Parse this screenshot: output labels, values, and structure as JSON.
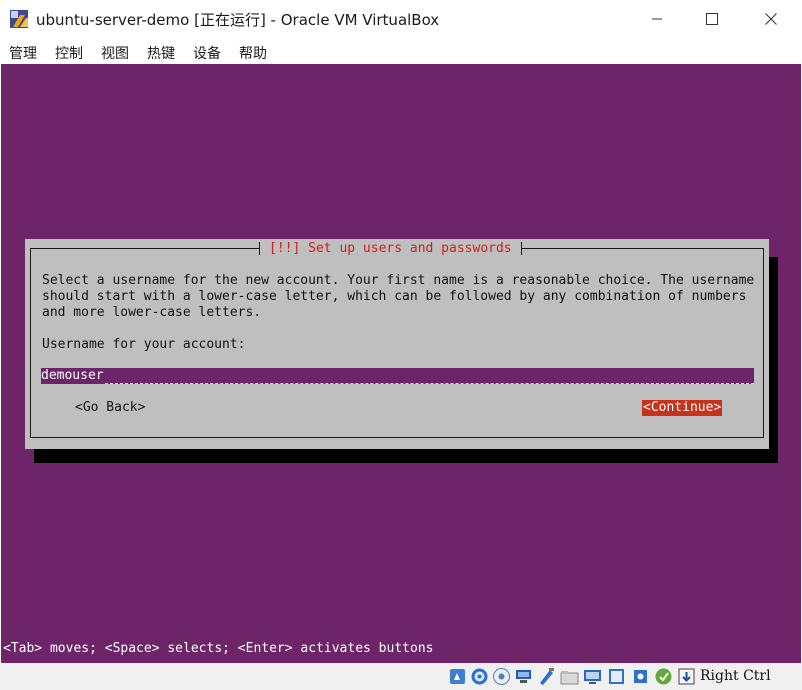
{
  "window": {
    "title": "ubuntu-server-demo [正在运行] - Oracle VM VirtualBox",
    "icons": {
      "app": "virtualbox-icon",
      "minimize": "minimize-icon",
      "maximize": "maximize-icon",
      "close": "close-icon"
    }
  },
  "menu": [
    "管理",
    "控制",
    "视图",
    "热键",
    "设备",
    "帮助"
  ],
  "installer": {
    "dialog_title": "[!!] Set up users and passwords",
    "description": "Select a username for the new account. Your first name is a reasonable choice. The username should start with a lower-case letter, which can be followed by any combination of numbers and more lower-case letters.",
    "prompt": "Username for your account:",
    "username_value": "demouser",
    "go_back_label": "<Go Back>",
    "continue_label": "<Continue>",
    "help_line": "<Tab> moves; <Space> selects; <Enter> activates buttons"
  },
  "statusbar": {
    "icons": [
      "hard-disk-icon",
      "optical-drive-icon",
      "audio-icon",
      "network-icon",
      "usb-icon",
      "shared-folders-icon",
      "display-icon",
      "video-capture-icon",
      "cpu-icon",
      "mouse-integration-icon",
      "keyboard-icon"
    ],
    "host_key": "Right Ctrl"
  },
  "colors": {
    "vm_background": "#6e2469",
    "dialog_background": "#bfbfbf",
    "title_red": "#cc2020",
    "button_selected": "#c8321a",
    "status_bar": "#f0f0f0"
  }
}
